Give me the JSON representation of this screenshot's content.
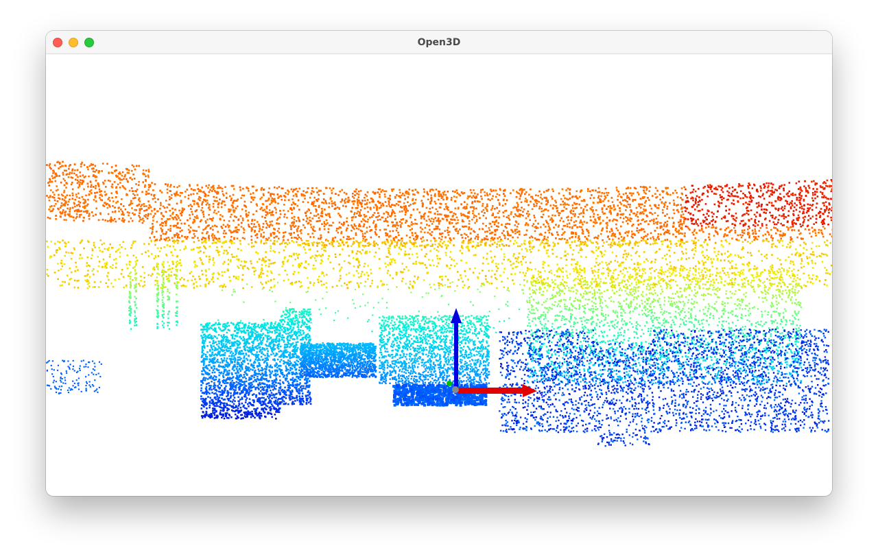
{
  "window": {
    "title": "Open3D",
    "traffic_lights": {
      "close": {
        "icon": "close-icon",
        "color": "#ff5f57"
      },
      "minimize": {
        "icon": "minimize-icon",
        "color": "#febc2e"
      },
      "maximize": {
        "icon": "maximize-icon",
        "color": "#28c840"
      }
    }
  },
  "viewport": {
    "background": "#ffffff",
    "colormap": [
      "#0000c8",
      "#0050ff",
      "#00b4ff",
      "#00f0dc",
      "#78ff78",
      "#f0f000",
      "#ff9600",
      "#ff5a00",
      "#dc0000"
    ],
    "axes": {
      "x_color": "#e00000",
      "y_color": "#00c000",
      "z_color": "#0000e0",
      "origin_color": "#888888"
    }
  }
}
